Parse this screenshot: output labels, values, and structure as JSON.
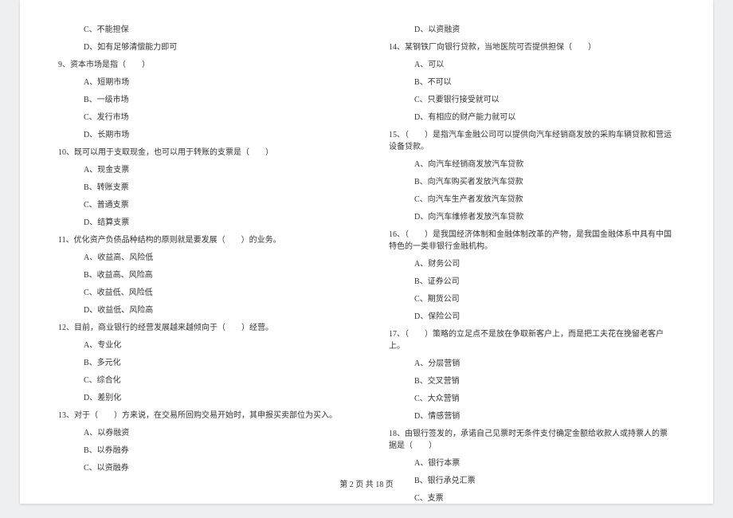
{
  "left_column": [
    {
      "type": "option",
      "text": "C、不能担保"
    },
    {
      "type": "option",
      "text": "D、如有足够清偿能力即可"
    },
    {
      "type": "question",
      "text": "9、资本市场是指（　　）"
    },
    {
      "type": "option",
      "text": "A、短期市场"
    },
    {
      "type": "option",
      "text": "B、一级市场"
    },
    {
      "type": "option",
      "text": "C、发行市场"
    },
    {
      "type": "option",
      "text": "D、长期市场"
    },
    {
      "type": "question",
      "text": "10、既可以用于支取现金，也可以用于转账的支票是（　　）"
    },
    {
      "type": "option",
      "text": "A、现金支票"
    },
    {
      "type": "option",
      "text": "B、转账支票"
    },
    {
      "type": "option",
      "text": "C、普通支票"
    },
    {
      "type": "option",
      "text": "D、结算支票"
    },
    {
      "type": "question",
      "text": "11、优化资产负债品种结构的原则就是要发展（　　）的业务。"
    },
    {
      "type": "option",
      "text": "A、收益高、风险低"
    },
    {
      "type": "option",
      "text": "B、收益高、风险高"
    },
    {
      "type": "option",
      "text": "C、收益低、风险低"
    },
    {
      "type": "option",
      "text": "D、收益低、风险高"
    },
    {
      "type": "question",
      "text": "12、目前，商业银行的经营发展越来越倾向于（　　）经营。"
    },
    {
      "type": "option",
      "text": "A、专业化"
    },
    {
      "type": "option",
      "text": "B、多元化"
    },
    {
      "type": "option",
      "text": "C、综合化"
    },
    {
      "type": "option",
      "text": "D、差别化"
    },
    {
      "type": "question",
      "text": "13、对于（　　）方来说，在交易所回购交易开始时，其申报买卖部位为买入。"
    },
    {
      "type": "option",
      "text": "A、以券融资"
    },
    {
      "type": "option",
      "text": "B、以券融券"
    },
    {
      "type": "option",
      "text": "C、以资融券"
    }
  ],
  "right_column": [
    {
      "type": "option",
      "text": "D、以资融资"
    },
    {
      "type": "question",
      "text": "14、某钢铁厂向银行贷款，当地医院可否提供担保（　　）"
    },
    {
      "type": "option",
      "text": "A、可以"
    },
    {
      "type": "option",
      "text": "B、不可以"
    },
    {
      "type": "option",
      "text": "C、只要银行接受就可以"
    },
    {
      "type": "option",
      "text": "D、有相应的财产能力就可以"
    },
    {
      "type": "question",
      "text": "15、（　　）是指汽车金融公司可以提供向汽车经销商发放的采购车辆贷款和营运设备贷款。"
    },
    {
      "type": "option",
      "text": "A、向汽车经销商发放汽车贷款"
    },
    {
      "type": "option",
      "text": "B、向汽车购买者发放汽车贷款"
    },
    {
      "type": "option",
      "text": "C、向汽车生产者发放汽车贷款"
    },
    {
      "type": "option",
      "text": "D、向汽车维修者发放汽车贷款"
    },
    {
      "type": "question",
      "text": "16、（　　）是我国经济体制和金融体制改革的产物，是我国金融体系中具有中国特色的一类非银行金融机构。"
    },
    {
      "type": "option",
      "text": "A、财务公司"
    },
    {
      "type": "option",
      "text": "B、证券公司"
    },
    {
      "type": "option",
      "text": "C、期货公司"
    },
    {
      "type": "option",
      "text": "D、保险公司"
    },
    {
      "type": "question",
      "text": "17、（　　）策略的立足点不是放在争取新客户上，而是把工夫花在挽留老客户上。"
    },
    {
      "type": "option",
      "text": "A、分层营销"
    },
    {
      "type": "option",
      "text": "B、交叉营销"
    },
    {
      "type": "option",
      "text": "C、大众营销"
    },
    {
      "type": "option",
      "text": "D、情感营销"
    },
    {
      "type": "question",
      "text": "18、由银行签发的，承诺自己见票时无条件支付确定金额给收款人或持票人的票据是（　　）"
    },
    {
      "type": "option",
      "text": "A、银行本票"
    },
    {
      "type": "option",
      "text": "B、银行承兑汇票"
    },
    {
      "type": "option",
      "text": "C、支票"
    }
  ],
  "footer": "第 2 页 共 18 页"
}
